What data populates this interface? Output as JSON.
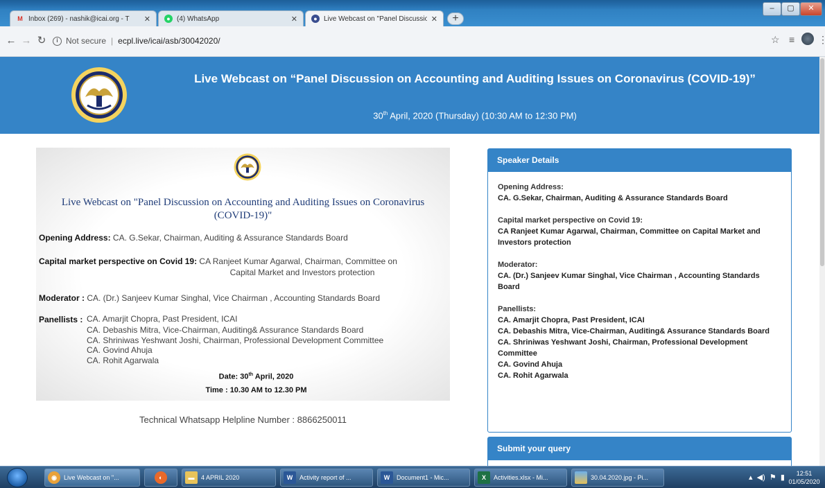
{
  "browser": {
    "tabs": [
      {
        "title": "Inbox (269) - nashik@icai.org - T",
        "favicon": "gmail-icon",
        "active": false
      },
      {
        "title": "(4) WhatsApp",
        "favicon": "whatsapp-icon",
        "active": false
      },
      {
        "title": "Live Webcast on \"Panel Discussio",
        "favicon": "icai-icon",
        "active": true
      }
    ],
    "security_label": "Not secure",
    "url": "ecpl.live/icai/asb/30042020/"
  },
  "header": {
    "title": "Live Webcast on “Panel Discussion on Accounting and Auditing Issues on Coronavirus (COVID-19)”",
    "date_day": "30",
    "date_suffix": "th",
    "date_rest": " April, 2020 (Thursday) (10:30 AM to 12:30 PM)"
  },
  "flyer": {
    "title": "Live Webcast on \"Panel Discussion on Accounting and Auditing Issues on Coronavirus (COVID-19)\"",
    "opening_label": "Opening Address:",
    "opening_value": " CA. G.Sekar, Chairman, Auditing & Assurance Standards Board",
    "capital_label": "Capital market perspective on Covid 19:",
    "capital_value": " CA Ranjeet Kumar Agarwal, Chairman, Committee on",
    "capital_value_2": "Capital Market and Investors protection",
    "moderator_label": "Moderator :",
    "moderator_value": " CA. (Dr.) Sanjeev Kumar Singhal, Vice Chairman , Accounting Standards Board",
    "panellists_label": "Panellists :",
    "panellists": [
      "CA. Amarjit Chopra, Past President, ICAI",
      "CA. Debashis Mitra, Vice-Chairman, Auditing& Assurance Standards Board",
      "CA. Shriniwas Yeshwant Joshi, Chairman, Professional Development Committee",
      "CA. Govind Ahuja",
      "CA. Rohit Agarwala"
    ],
    "date_prefix": "Date: 30",
    "date_suffix": "th",
    "date_rest": " April, 2020",
    "time": "Time : 10.30 AM to 12.30 PM"
  },
  "helpline": "Technical Whatsapp Helpline Number : 8866250011",
  "speaker_details": {
    "heading": "Speaker Details",
    "opening_label": "Opening Address:",
    "opening_value": "CA. G.Sekar, Chairman, Auditing & Assurance Standards Board",
    "capital_label": "Capital market perspective on Covid 19:",
    "capital_value": "CA Ranjeet Kumar Agarwal, Chairman, Committee on Capital Market and Investors protection",
    "moderator_label": "Moderator:",
    "moderator_value": "CA. (Dr.) Sanjeev Kumar Singhal, Vice Chairman , Accounting Standards Board",
    "panellists_label": "Panellists:",
    "panellists": [
      "CA. Amarjit Chopra, Past President, ICAI",
      "CA. Debashis Mitra, Vice-Chairman, Auditing& Assurance Standards Board",
      "CA. Shriniwas Yeshwant Joshi, Chairman, Professional Development Committee",
      "CA. Govind Ahuja",
      "CA. Rohit Agarwala"
    ]
  },
  "query": {
    "heading": "Submit your query"
  },
  "taskbar": {
    "items": [
      {
        "label": "Live Webcast on \"...",
        "icon": "chrome-icon",
        "color": "#e9a23b"
      },
      {
        "label": "",
        "icon": "firefox-icon",
        "color": "#e8692a"
      },
      {
        "label": "4 APRIL 2020",
        "icon": "folder-icon",
        "color": "#e8c35a"
      },
      {
        "label": "Activity report of ...",
        "icon": "word-icon",
        "color": "#2b5797"
      },
      {
        "label": "Document1 - Mic...",
        "icon": "word-icon",
        "color": "#2b5797"
      },
      {
        "label": "Activities.xlsx - Mi...",
        "icon": "excel-icon",
        "color": "#1e7145"
      },
      {
        "label": "30.04.2020.jpg - Pi...",
        "icon": "picture-icon",
        "color": "#3f8fd0"
      }
    ],
    "time": "12:51",
    "date": "01/05/2020"
  },
  "colors": {
    "brand_blue": "#3584c7",
    "flyer_title": "#1f3c78"
  }
}
